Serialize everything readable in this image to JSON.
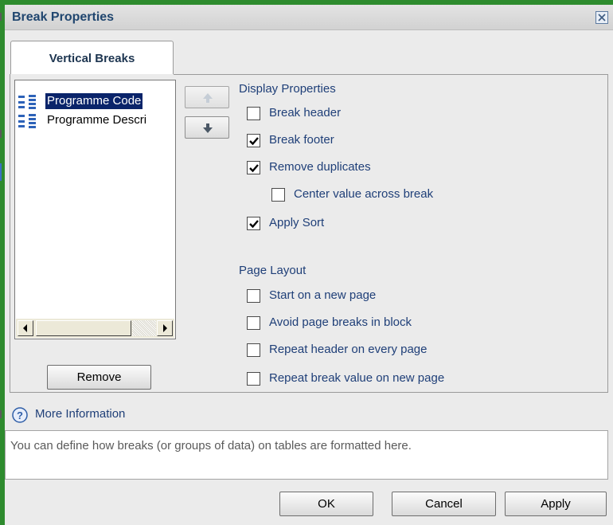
{
  "dialog": {
    "title": "Break Properties",
    "close_icon": "close-icon"
  },
  "tabs": [
    {
      "label": "Vertical Breaks",
      "active": true
    }
  ],
  "breaks_list": {
    "items": [
      {
        "label": "Programme Code",
        "icon": "dimension-icon",
        "selected": true
      },
      {
        "label": "Programme Descri",
        "icon": "dimension-icon",
        "selected": false
      }
    ],
    "remove_label": "Remove"
  },
  "move_buttons": {
    "up_icon": "arrow-up-icon",
    "down_icon": "arrow-down-icon"
  },
  "display_properties": {
    "heading": "Display Properties",
    "options": [
      {
        "label": "Break header",
        "checked": false
      },
      {
        "label": "Break footer",
        "checked": true
      },
      {
        "label": "Remove duplicates",
        "checked": true
      },
      {
        "label": "Center value across break",
        "checked": false
      },
      {
        "label": "Apply Sort",
        "checked": true
      }
    ]
  },
  "page_layout": {
    "heading": "Page Layout",
    "options": [
      {
        "label": "Start on a new page",
        "checked": false
      },
      {
        "label": "Avoid page breaks in block",
        "checked": false
      },
      {
        "label": "Repeat header on every page",
        "checked": false
      },
      {
        "label": "Repeat break value on new page",
        "checked": false
      }
    ]
  },
  "more_info": {
    "label": "More Information",
    "icon": "help-icon",
    "text": "You can define how breaks (or groups of data) on tables are formatted here."
  },
  "footer_buttons": {
    "ok": "OK",
    "cancel": "Cancel",
    "apply": "Apply"
  },
  "colors": {
    "accent_text": "#1f3f78",
    "selection": "#0a246a",
    "title_text": "#20466f"
  }
}
